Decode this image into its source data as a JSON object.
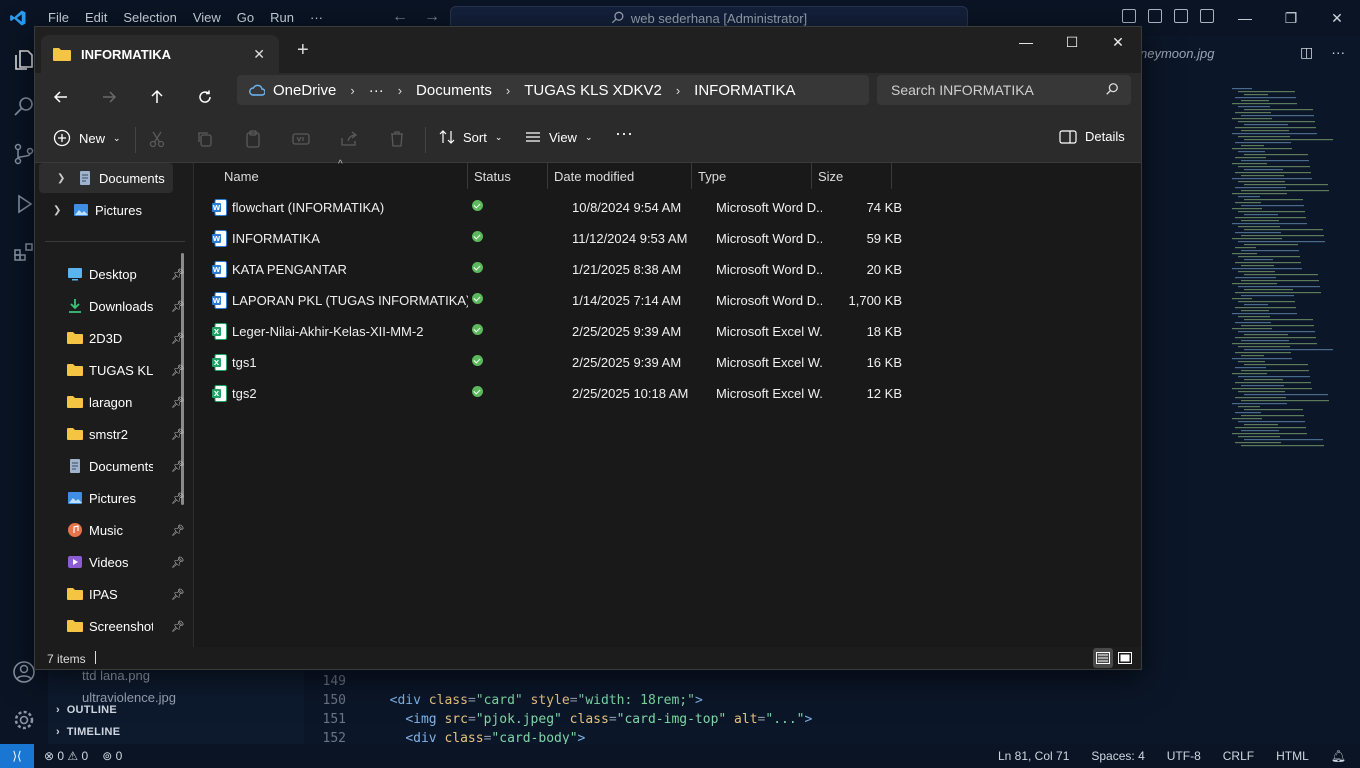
{
  "vscode": {
    "menu": [
      "File",
      "Edit",
      "Selection",
      "View",
      "Go",
      "Run",
      "···"
    ],
    "command_center": "web sederhana [Administrator]",
    "editor_tab": "neymoon.jpg",
    "sidebar_files": [
      "ttd lana.png",
      "ultraviolence.jpg"
    ],
    "sidebar_sections": [
      "OUTLINE",
      "TIMELINE"
    ],
    "code_lines": [
      {
        "n": "149",
        "indent": "",
        "parts": []
      },
      {
        "n": "150",
        "indent": "  ",
        "parts": [
          [
            "tag",
            "<div "
          ],
          [
            "attr",
            "class"
          ],
          [
            "pun",
            "="
          ],
          [
            "str",
            "\"card\""
          ],
          [
            "attr",
            " style"
          ],
          [
            "pun",
            "="
          ],
          [
            "str",
            "\"width: 18rem;\""
          ],
          [
            "tag",
            ">"
          ]
        ]
      },
      {
        "n": "151",
        "indent": "    ",
        "parts": [
          [
            "tag",
            "<img "
          ],
          [
            "attr",
            "src"
          ],
          [
            "pun",
            "="
          ],
          [
            "str",
            "\"pjok.jpeg\""
          ],
          [
            "attr",
            " class"
          ],
          [
            "pun",
            "="
          ],
          [
            "str",
            "\"card-img-top\""
          ],
          [
            "attr",
            " alt"
          ],
          [
            "pun",
            "="
          ],
          [
            "str",
            "\"...\""
          ],
          [
            "tag",
            ">"
          ]
        ]
      },
      {
        "n": "152",
        "indent": "    ",
        "parts": [
          [
            "tag",
            "<div "
          ],
          [
            "attr",
            "class"
          ],
          [
            "pun",
            "="
          ],
          [
            "str",
            "\"card-body\""
          ],
          [
            "tag",
            ">"
          ]
        ]
      }
    ],
    "status": {
      "errors": "0",
      "warnings": "0",
      "ports": "0",
      "position": "Ln 81, Col 71",
      "spaces": "Spaces: 4",
      "encoding": "UTF-8",
      "eol": "CRLF",
      "language": "HTML"
    }
  },
  "explorer": {
    "tab_title": "INFORMATIKA",
    "breadcrumb": [
      "OneDrive",
      "···",
      "Documents",
      "TUGAS KLS XDKV2",
      "INFORMATIKA"
    ],
    "search_placeholder": "Search INFORMATIKA",
    "toolbar": {
      "new": "New",
      "sort": "Sort",
      "view": "View",
      "details": "Details"
    },
    "nav_top": [
      {
        "label": "Documents",
        "icon": "documents-icon",
        "selected": true
      },
      {
        "label": "Pictures",
        "icon": "pictures-icon",
        "selected": false
      }
    ],
    "nav_quick": [
      {
        "label": "Desktop",
        "icon": "desktop-icon"
      },
      {
        "label": "Downloads",
        "icon": "download-icon"
      },
      {
        "label": "2D3D",
        "icon": "folder-icon"
      },
      {
        "label": "TUGAS KLS X",
        "icon": "folder-icon"
      },
      {
        "label": "laragon",
        "icon": "folder-icon"
      },
      {
        "label": "smstr2",
        "icon": "folder-icon"
      },
      {
        "label": "Documents",
        "icon": "documents-icon"
      },
      {
        "label": "Pictures",
        "icon": "pictures-icon"
      },
      {
        "label": "Music",
        "icon": "music-icon"
      },
      {
        "label": "Videos",
        "icon": "videos-icon"
      },
      {
        "label": "IPAS",
        "icon": "folder-icon"
      },
      {
        "label": "Screenshots",
        "icon": "folder-icon"
      }
    ],
    "columns": [
      "Name",
      "Status",
      "Date modified",
      "Type",
      "Size"
    ],
    "files": [
      {
        "name": "flowchart (INFORMATIKA)",
        "kind": "word",
        "date": "10/8/2024 9:54 AM",
        "type": "Microsoft Word D...",
        "size": "74 KB"
      },
      {
        "name": "INFORMATIKA",
        "kind": "word",
        "date": "11/12/2024 9:53 AM",
        "type": "Microsoft Word D...",
        "size": "59 KB"
      },
      {
        "name": "KATA PENGANTAR",
        "kind": "word",
        "date": "1/21/2025 8:38 AM",
        "type": "Microsoft Word D...",
        "size": "20 KB"
      },
      {
        "name": "LAPORAN PKL (TUGAS INFORMATIKA)",
        "kind": "word",
        "date": "1/14/2025 7:14 AM",
        "type": "Microsoft Word D...",
        "size": "1,700 KB"
      },
      {
        "name": "Leger-Nilai-Akhir-Kelas-XII-MM-2",
        "kind": "excel",
        "date": "2/25/2025 9:39 AM",
        "type": "Microsoft Excel W...",
        "size": "18 KB"
      },
      {
        "name": "tgs1",
        "kind": "excel",
        "date": "2/25/2025 9:39 AM",
        "type": "Microsoft Excel W...",
        "size": "16 KB"
      },
      {
        "name": "tgs2",
        "kind": "excel",
        "date": "2/25/2025 10:18 AM",
        "type": "Microsoft Excel W...",
        "size": "12 KB"
      }
    ],
    "item_count": "7 items",
    "colors": {
      "word": "#2b7cd3",
      "excel": "#21a366",
      "folder": "#f4c542",
      "sync_ok": "#5cb85c"
    }
  }
}
